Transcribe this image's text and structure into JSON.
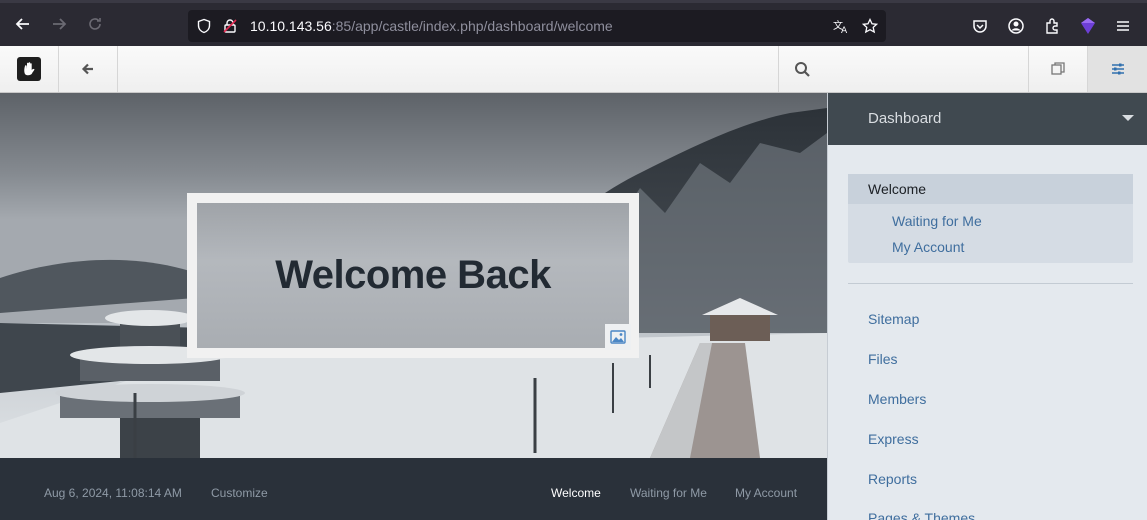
{
  "browser": {
    "url_host": "10.10.143.56",
    "url_rest": ":85/app/castle/index.php/dashboard/welcome"
  },
  "toolbar": {
    "search_placeholder": ""
  },
  "hero": {
    "title": "Welcome Back"
  },
  "footer": {
    "timestamp": "Aug 6, 2024, 11:08:14 AM",
    "customize": "Customize",
    "links": [
      "Welcome",
      "Waiting for Me",
      "My Account"
    ]
  },
  "panel": {
    "header": "Dashboard",
    "current": "Welcome",
    "sub_items": [
      "Waiting for Me",
      "My Account"
    ],
    "items": [
      "Sitemap",
      "Files",
      "Members",
      "Express",
      "Reports",
      "Pages & Themes"
    ]
  },
  "colors": {
    "link": "#3f6e9e",
    "panel_header": "#404950",
    "footer_bg": "#2a313a"
  }
}
